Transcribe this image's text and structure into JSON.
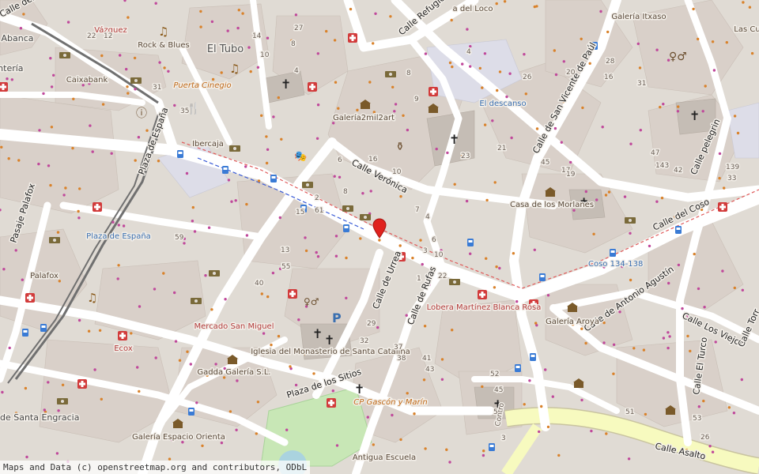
{
  "attribution": "Maps and Data (c) openstreetmap.org and contributors, ODbL",
  "colors": {
    "street": "#ffffff",
    "building": "#d9d0c9",
    "block": "#e0dbd4",
    "park": "#c8e7b6",
    "major_road": "#f7fabf",
    "rail": "#707070",
    "marker": "#e0221e"
  },
  "streets": [
    "Calle del Coso",
    "Calle Refugio",
    "Calle de San Vicente de Paúl",
    "Calle Verónica",
    "Calle pelegrin",
    "Calle del Coso",
    "Calle de Urrea",
    "Calle de Rufas",
    "Calle de Antonio Agustín",
    "Calle Los Viejos",
    "Calle El Turco",
    "Calle Torr",
    "Plaza de España",
    "Pasaje Palafox",
    "Plaza de los Sitios",
    "Calle Asalto",
    "Coso 134-138",
    "Contro"
  ],
  "places": [
    "Abanca",
    "antería",
    "Vázquez",
    "Rock & Blues",
    "El Tubo",
    "Caixabank",
    "Puerta Cinegio",
    "Ibercaja",
    "Plaza de España",
    "Palafox",
    "Ecox",
    "Plaza de Santa Engracia",
    "Gadda Galería S.L.",
    "Galería Espacio Orienta",
    "Mercado San Miguel",
    "Iglesia del Monasterio de Santa Catalina",
    "CP Gascón y Marín",
    "Antigua Escuela",
    "Lobera Martínez Blanca Rosa",
    "Galería Aroya",
    "Casa de los Morlanes",
    "El descanso",
    "Galería2mil2art",
    "Galería Itxaso",
    "a del Loco",
    "Las Cu",
    "Calle"
  ],
  "house_numbers": [
    "22",
    "12",
    "14",
    "10",
    "8",
    "4",
    "27",
    "35",
    "31",
    "4",
    "6",
    "2",
    "61",
    "8",
    "9",
    "10",
    "7",
    "4",
    "6",
    "29",
    "32",
    "37",
    "38",
    "41",
    "43",
    "45",
    "52",
    "51",
    "53",
    "26",
    "28",
    "31",
    "33",
    "139",
    "143",
    "42",
    "47",
    "45",
    "17",
    "19",
    "21",
    "23",
    "26",
    "20",
    "16",
    "22",
    "40",
    "55",
    "59",
    "13",
    "15",
    "16",
    "8",
    "10",
    "3",
    "1",
    "5",
    "3"
  ]
}
